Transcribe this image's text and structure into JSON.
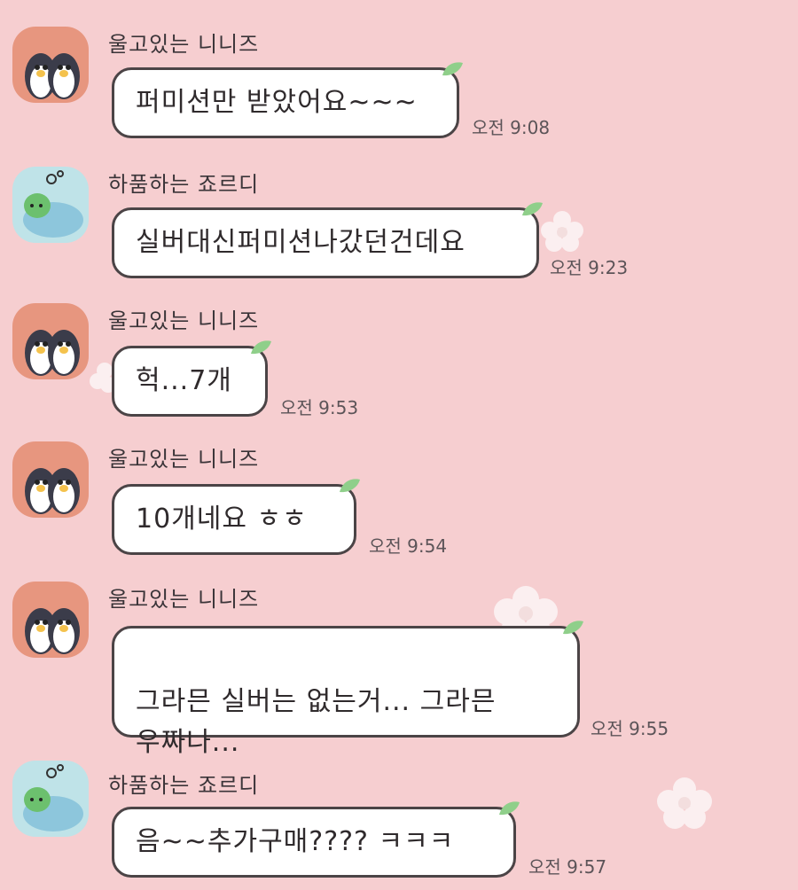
{
  "messages": [
    {
      "sender": "울고있는 니니즈",
      "avatar": "crying-penguins-avatar",
      "text": "퍼미션만 받았어요~~~",
      "time": "오전 9:08"
    },
    {
      "sender": "하품하는 죠르디",
      "avatar": "sleeping-jordy-avatar",
      "text": "실버대신퍼미션나갔던건데요",
      "time": "오전 9:23"
    },
    {
      "sender": "울고있는 니니즈",
      "avatar": "crying-penguins-avatar",
      "text": "헉...7개",
      "time": "오전 9:53"
    },
    {
      "sender": "울고있는 니니즈",
      "avatar": "crying-penguins-avatar",
      "text": "10개네요 ㅎㅎ",
      "time": "오전 9:54"
    },
    {
      "sender": "울고있는 니니즈",
      "avatar": "crying-penguins-avatar",
      "text": "그라믄 실버는 없는거... 그라믄\n우짜나...",
      "time": "오전 9:55"
    },
    {
      "sender": "하품하는 죠르디",
      "avatar": "sleeping-jordy-avatar",
      "text": "음~~추가구매???? ㅋㅋㅋ",
      "time": "오전 9:57"
    }
  ],
  "colors": {
    "background": "#f6ced0",
    "bubble": "#ffffff",
    "border": "#4b4446",
    "leaf": "#8fcf8a"
  }
}
